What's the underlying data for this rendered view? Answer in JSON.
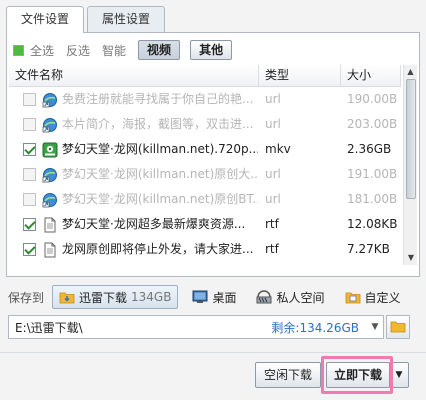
{
  "tabs": [
    {
      "label": "文件设置",
      "active": true
    },
    {
      "label": "属性设置",
      "active": false
    }
  ],
  "filters": {
    "select_all": "全选",
    "invert": "反选",
    "smart": "智能",
    "video": "视频",
    "other": "其他"
  },
  "table": {
    "headers": [
      "文件名称",
      "类型",
      "大小"
    ],
    "rows": [
      {
        "name": "免费注册就能寻找属于你自己的艳...",
        "type": "url",
        "size": "190.00B",
        "checked": false,
        "icon": "internet-shortcut-icon"
      },
      {
        "name": "本片简介，海报，截图等，双击进...",
        "type": "url",
        "size": "203.00B",
        "checked": false,
        "icon": "internet-shortcut-icon"
      },
      {
        "name": "梦幻天堂·龙网(killman.net).720p....",
        "type": "mkv",
        "size": "2.36GB",
        "checked": true,
        "icon": "video-file-icon"
      },
      {
        "name": "梦幻天堂·龙网(killman.net)原创大...",
        "type": "url",
        "size": "191.00B",
        "checked": false,
        "icon": "internet-shortcut-icon"
      },
      {
        "name": "梦幻天堂·龙网(killman.net)原创BT...",
        "type": "url",
        "size": "181.00B",
        "checked": false,
        "icon": "internet-shortcut-icon"
      },
      {
        "name": "梦幻天堂·龙网超多最新爆爽资源...",
        "type": "rtf",
        "size": "12.08KB",
        "checked": true,
        "icon": "document-icon"
      },
      {
        "name": "龙网原创即将停止外发，请大家进...",
        "type": "rtf",
        "size": "7.27KB",
        "checked": true,
        "icon": "document-icon"
      }
    ]
  },
  "save": {
    "label": "保存到",
    "locations": [
      {
        "label": "迅雷下载",
        "size": "134GB",
        "icon": "folder-download-icon",
        "selected": true
      },
      {
        "label": "桌面",
        "icon": "desktop-icon",
        "selected": false
      },
      {
        "label": "私人空间",
        "icon": "private-space-icon",
        "selected": false
      },
      {
        "label": "自定义",
        "icon": "custom-folder-icon",
        "selected": false
      }
    ],
    "path": "E:\\迅雷下载\\",
    "free": "剩余:134.26GB"
  },
  "buttons": {
    "idle_download": "空闲下载",
    "download_now": "立即下载"
  },
  "colors": {
    "highlight": "#f27ab0",
    "free_space": "#2a6fc9"
  }
}
